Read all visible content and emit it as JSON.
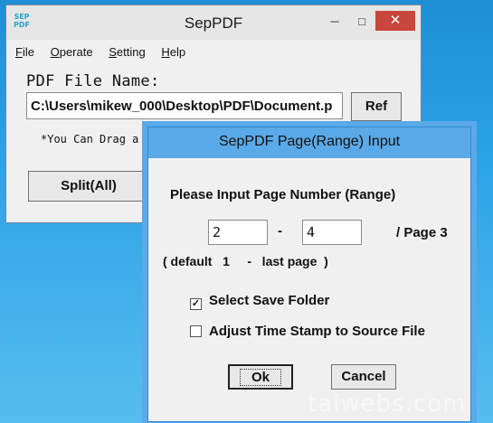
{
  "main_window": {
    "app_icon_text": "SEP PDF",
    "title": "SepPDF",
    "controls": {
      "minimize": "─",
      "maximize": "□",
      "close": "✕"
    },
    "menu": [
      "File",
      "Operate",
      "Setting",
      "Help"
    ],
    "pdf_label": "PDF File Name:",
    "pdf_path": "C:\\Users\\mikew_000\\Desktop\\PDF\\Document.p",
    "ref_label": "Ref",
    "drag_hint": "*You Can Drag a PD",
    "split_label": "Split(All)"
  },
  "dialog": {
    "title": "SepPDF Page(Range) Input",
    "heading": "Please Input Page Number (Range)",
    "page_from": "2",
    "page_to": "4",
    "dash": "-",
    "page_total": "/ Page 3",
    "default_info": "( default   1     -   last page  )",
    "options": [
      {
        "label": "Select Save Folder",
        "checked": true,
        "mark": "✓"
      },
      {
        "label": "Adjust Time Stamp to Source File",
        "checked": false,
        "mark": ""
      }
    ],
    "ok_label": "Ok",
    "cancel_label": "Cancel"
  },
  "watermark": "taiwebs.com"
}
